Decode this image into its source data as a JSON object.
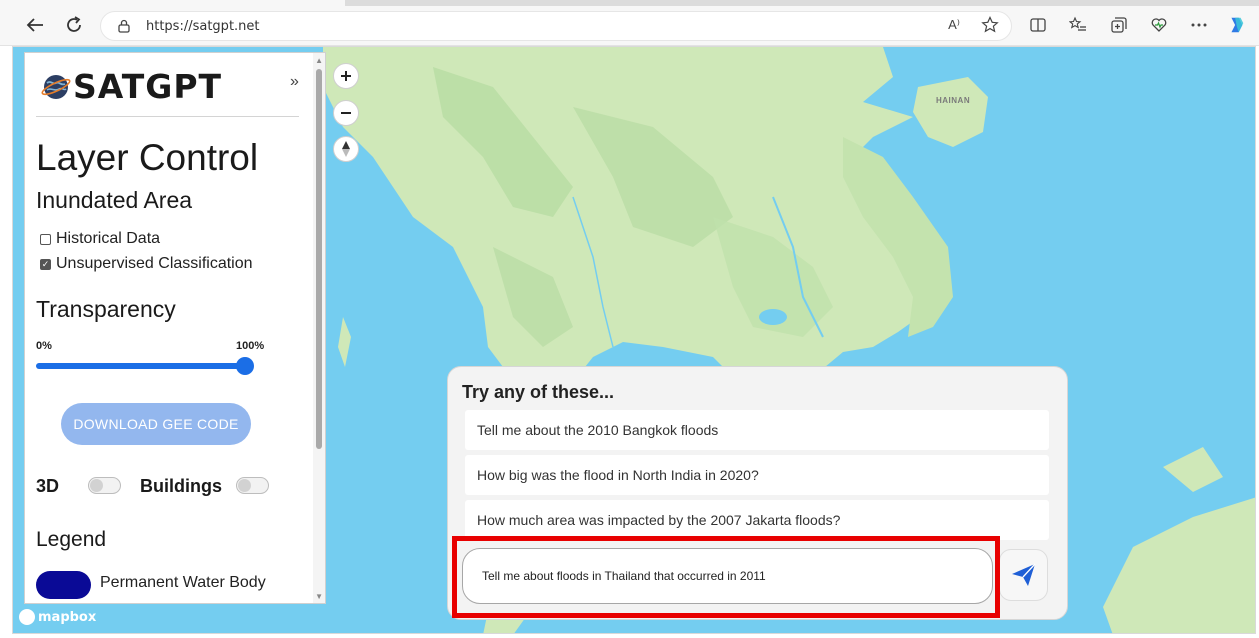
{
  "browser": {
    "url": "https://satgpt.net",
    "read_aloud_icon": "A⁾"
  },
  "sidebar": {
    "brand": "SATGPT",
    "collapse_label": "»",
    "layer_control_title": "Layer Control",
    "inundated_area_title": "Inundated Area",
    "checkboxes": [
      {
        "label": "Historical Data",
        "checked": false
      },
      {
        "label": "Unsupervised Classification",
        "checked": true
      }
    ],
    "transparency_title": "Transparency",
    "transparency_min": "0%",
    "transparency_max": "100%",
    "transparency_value": 1.0,
    "download_button": "DOWNLOAD GEE CODE",
    "toggle_3d_label": "3D",
    "toggle_buildings_label": "Buildings",
    "toggle_3d_on": false,
    "toggle_buildings_on": false,
    "legend_title": "Legend",
    "legend_items": [
      {
        "label": "Permanent Water Body",
        "color": "#0a0a96"
      }
    ]
  },
  "map": {
    "attribution": "mapbox",
    "label_hainan": "HAINAN",
    "water_color": "#74cdf0",
    "land_color": "#c8e6b0"
  },
  "suggestions": {
    "title": "Try any of these...",
    "items": [
      "Tell me about the 2010 Bangkok floods",
      "How big was the flood in North India in 2020?",
      "How much area was impacted by the 2007 Jakarta floods?"
    ]
  },
  "chat": {
    "input_value": "Tell me about floods in Thailand that occurred in 2011"
  },
  "colors": {
    "accent": "#1b6ee6",
    "highlight": "#e80000"
  }
}
